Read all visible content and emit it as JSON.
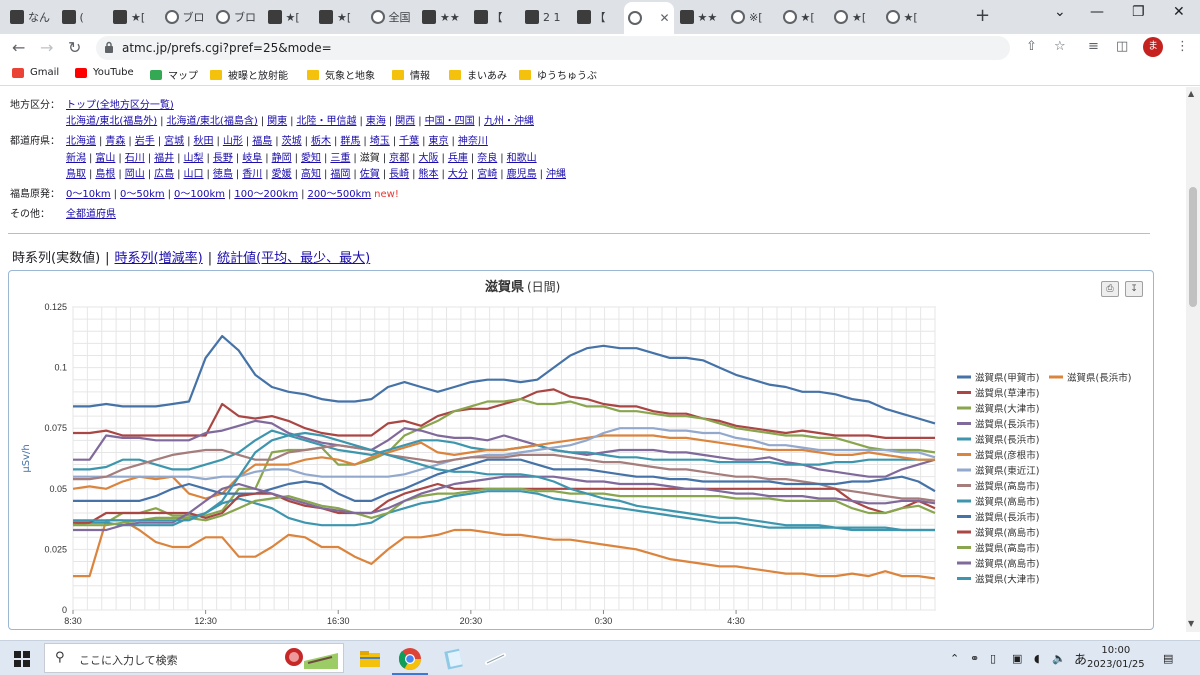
{
  "browser": {
    "tabs": [
      {
        "title": "なん",
        "icon": "site-icon"
      },
      {
        "title": "(",
        "icon": "site-icon"
      },
      {
        "title": "★[",
        "icon": "site-icon"
      },
      {
        "title": "ブロ",
        "icon": "info-icon"
      },
      {
        "title": "ブロ",
        "icon": "info-icon"
      },
      {
        "title": "★[",
        "icon": "site-icon"
      },
      {
        "title": "★[",
        "icon": "site-icon"
      },
      {
        "title": "全国",
        "icon": "globe-icon"
      },
      {
        "title": "★★",
        "icon": "site-icon"
      },
      {
        "title": "【",
        "icon": "site-icon"
      },
      {
        "title": "2 1",
        "icon": "site-icon"
      },
      {
        "title": "【",
        "icon": "site-icon"
      },
      {
        "title": "",
        "icon": "globe-icon",
        "active": true
      },
      {
        "title": "★★",
        "icon": "site-icon"
      },
      {
        "title": "※[",
        "icon": "globe-icon"
      },
      {
        "title": "★[",
        "icon": "globe-icon"
      },
      {
        "title": "★[",
        "icon": "globe-icon"
      },
      {
        "title": "★[",
        "icon": "globe-icon"
      }
    ],
    "url": "atmc.jp/prefs.cgi?pref=25&mode=",
    "avatar_letter": "ま",
    "bookmarks": [
      {
        "label": "Gmail",
        "icon": "gmail-icon"
      },
      {
        "label": "YouTube",
        "icon": "youtube-icon"
      },
      {
        "label": "マップ",
        "icon": "maps-icon"
      },
      {
        "label": "被曝と放射能",
        "icon": "folder-icon"
      },
      {
        "label": "気象と地象",
        "icon": "folder-icon"
      },
      {
        "label": "情報",
        "icon": "folder-icon"
      },
      {
        "label": "まいあみ",
        "icon": "folder-icon"
      },
      {
        "label": "ゆうちゅうぶ",
        "icon": "folder-icon"
      }
    ]
  },
  "nav": {
    "region_label": "地方区分：",
    "region_line1": [
      "トップ(全地方区分一覧)"
    ],
    "region_line2": [
      "北海道/東北(福島外)",
      "北海道/東北(福島含)",
      "関東",
      "北陸・甲信越",
      "東海",
      "関西",
      "中国・四国",
      "九州・沖縄"
    ],
    "pref_label": "都道府県：",
    "pref_line1": [
      "北海道",
      "青森",
      "岩手",
      "宮城",
      "秋田",
      "山形",
      "福島",
      "茨城",
      "栃木",
      "群馬",
      "埼玉",
      "千葉",
      "東京",
      "神奈川"
    ],
    "pref_line2": [
      "新潟",
      "富山",
      "石川",
      "福井",
      "山梨",
      "長野",
      "岐阜",
      "静岡",
      "愛知",
      "三重",
      "滋賀",
      "京都",
      "大阪",
      "兵庫",
      "奈良",
      "和歌山"
    ],
    "pref_line3": [
      "鳥取",
      "島根",
      "岡山",
      "広島",
      "山口",
      "徳島",
      "香川",
      "愛媛",
      "高知",
      "福岡",
      "佐賀",
      "長崎",
      "熊本",
      "大分",
      "宮崎",
      "鹿児島",
      "沖縄"
    ],
    "fuku_label": "福島原発：",
    "fuku_links": [
      "0〜10km",
      "0〜50km",
      "0〜100km",
      "100〜200km",
      "200〜500km"
    ],
    "new_badge": "new!",
    "other_label": "その他：",
    "other_links": [
      "全都道府県"
    ]
  },
  "view_tabs": {
    "current": "時系列(実数値)",
    "link1": "時系列(増減率)",
    "link2": "統計値(平均、最少、最大)"
  },
  "chart_data": {
    "type": "line",
    "title": "滋賀県",
    "subtitle": "(日間)",
    "ylabel": "μSv/h",
    "ylim": [
      0,
      0.125
    ],
    "yticks": [
      "0",
      "0.025",
      "0.05",
      "0.075",
      "0.1",
      "0.125"
    ],
    "xticks": [
      "8:30",
      "12:30",
      "16:30",
      "20:30",
      "0:30",
      "4:30"
    ],
    "grid": true,
    "legend_position": "right",
    "series": [
      {
        "name": "滋賀県(甲賀市)",
        "color": "#4572a7",
        "values": [
          0.084,
          0.084,
          0.085,
          0.084,
          0.084,
          0.084,
          0.085,
          0.086,
          0.104,
          0.113,
          0.107,
          0.097,
          0.092,
          0.09,
          0.089,
          0.087,
          0.086,
          0.086,
          0.087,
          0.092,
          0.094,
          0.092,
          0.09,
          0.092,
          0.094,
          0.095,
          0.095,
          0.094,
          0.095,
          0.1,
          0.105,
          0.108,
          0.109,
          0.108,
          0.108,
          0.106,
          0.104,
          0.104,
          0.103,
          0.1,
          0.097,
          0.095,
          0.093,
          0.092,
          0.09,
          0.09,
          0.089,
          0.087,
          0.086,
          0.083,
          0.081,
          0.079,
          0.077
        ]
      },
      {
        "name": "滋賀県(長浜市)",
        "color": "#db843d",
        "values": [
          0.014,
          0.014,
          0.037,
          0.037,
          0.033,
          0.028,
          0.026,
          0.026,
          0.03,
          0.03,
          0.022,
          0.022,
          0.026,
          0.031,
          0.03,
          0.026,
          0.026,
          0.022,
          0.019,
          0.025,
          0.03,
          0.03,
          0.031,
          0.033,
          0.033,
          0.032,
          0.031,
          0.031,
          0.03,
          0.029,
          0.029,
          0.028,
          0.027,
          0.026,
          0.025,
          0.023,
          0.021,
          0.02,
          0.019,
          0.018,
          0.018,
          0.017,
          0.016,
          0.015,
          0.015,
          0.014,
          0.014,
          0.015,
          0.014,
          0.016,
          0.014,
          0.014,
          0.013
        ]
      },
      {
        "name": "滋賀県(草津市)",
        "color": "#aa4643",
        "values": [
          0.073,
          0.073,
          0.074,
          0.072,
          0.072,
          0.072,
          0.072,
          0.072,
          0.072,
          0.085,
          0.08,
          0.079,
          0.08,
          0.078,
          0.075,
          0.073,
          0.072,
          0.072,
          0.072,
          0.077,
          0.078,
          0.076,
          0.08,
          0.082,
          0.083,
          0.083,
          0.085,
          0.087,
          0.09,
          0.091,
          0.088,
          0.087,
          0.085,
          0.084,
          0.084,
          0.082,
          0.081,
          0.081,
          0.079,
          0.078,
          0.076,
          0.075,
          0.074,
          0.073,
          0.074,
          0.073,
          0.072,
          0.072,
          0.072,
          0.071,
          0.071,
          0.071,
          0.071
        ]
      },
      {
        "name": "滋賀県(大津市)",
        "color": "#89a54e",
        "values": [
          0.035,
          0.036,
          0.036,
          0.04,
          0.04,
          0.042,
          0.039,
          0.039,
          0.039,
          0.041,
          0.05,
          0.05,
          0.065,
          0.066,
          0.066,
          0.067,
          0.06,
          0.06,
          0.062,
          0.065,
          0.072,
          0.075,
          0.078,
          0.082,
          0.084,
          0.086,
          0.086,
          0.087,
          0.085,
          0.085,
          0.086,
          0.084,
          0.084,
          0.082,
          0.082,
          0.081,
          0.08,
          0.08,
          0.079,
          0.077,
          0.075,
          0.074,
          0.073,
          0.072,
          0.072,
          0.071,
          0.071,
          0.069,
          0.067,
          0.066,
          0.066,
          0.066,
          0.065
        ]
      },
      {
        "name": "滋賀県(長浜市)",
        "color": "#80699b",
        "values": [
          0.062,
          0.062,
          0.072,
          0.071,
          0.071,
          0.07,
          0.07,
          0.07,
          0.073,
          0.074,
          0.076,
          0.078,
          0.077,
          0.073,
          0.071,
          0.069,
          0.068,
          0.067,
          0.066,
          0.07,
          0.075,
          0.074,
          0.072,
          0.071,
          0.071,
          0.07,
          0.072,
          0.07,
          0.068,
          0.066,
          0.065,
          0.064,
          0.065,
          0.066,
          0.066,
          0.066,
          0.065,
          0.065,
          0.064,
          0.063,
          0.062,
          0.062,
          0.063,
          0.061,
          0.06,
          0.058,
          0.057,
          0.056,
          0.055,
          0.055,
          0.058,
          0.06,
          0.062
        ]
      },
      {
        "name": "滋賀県(長浜市)",
        "color": "#3d96ae",
        "values": [
          0.058,
          0.058,
          0.059,
          0.062,
          0.062,
          0.06,
          0.058,
          0.058,
          0.06,
          0.062,
          0.065,
          0.07,
          0.074,
          0.072,
          0.07,
          0.068,
          0.066,
          0.065,
          0.064,
          0.066,
          0.068,
          0.07,
          0.07,
          0.069,
          0.067,
          0.066,
          0.066,
          0.067,
          0.068,
          0.066,
          0.065,
          0.065,
          0.064,
          0.063,
          0.063,
          0.062,
          0.062,
          0.062,
          0.062,
          0.061,
          0.061,
          0.061,
          0.061,
          0.06,
          0.06,
          0.06,
          0.061,
          0.061,
          0.062,
          0.062,
          0.062,
          0.062,
          0.062
        ]
      },
      {
        "name": "滋賀県(彦根市)",
        "color": "#db843d",
        "values": [
          0.05,
          0.051,
          0.05,
          0.053,
          0.055,
          0.054,
          0.055,
          0.048,
          0.046,
          0.048,
          0.055,
          0.06,
          0.06,
          0.06,
          0.062,
          0.063,
          0.062,
          0.06,
          0.063,
          0.065,
          0.067,
          0.069,
          0.065,
          0.064,
          0.065,
          0.066,
          0.066,
          0.067,
          0.068,
          0.069,
          0.07,
          0.071,
          0.072,
          0.072,
          0.072,
          0.072,
          0.071,
          0.071,
          0.07,
          0.069,
          0.068,
          0.067,
          0.066,
          0.066,
          0.066,
          0.065,
          0.064,
          0.064,
          0.065,
          0.064,
          0.063,
          0.062,
          0.062
        ]
      },
      {
        "name": "滋賀県(東近江)",
        "color": "#92a8cd",
        "values": [
          0.055,
          0.055,
          0.055,
          0.055,
          0.055,
          0.055,
          0.055,
          0.055,
          0.054,
          0.055,
          0.055,
          0.057,
          0.058,
          0.058,
          0.056,
          0.055,
          0.055,
          0.055,
          0.055,
          0.055,
          0.056,
          0.058,
          0.06,
          0.062,
          0.063,
          0.064,
          0.064,
          0.065,
          0.066,
          0.067,
          0.068,
          0.07,
          0.073,
          0.075,
          0.075,
          0.075,
          0.074,
          0.074,
          0.073,
          0.073,
          0.071,
          0.07,
          0.068,
          0.068,
          0.067,
          0.066,
          0.066,
          0.066,
          0.066,
          0.066,
          0.065,
          0.065,
          0.063
        ]
      },
      {
        "name": "滋賀県(高島市)",
        "color": "#a47d7c",
        "values": [
          0.054,
          0.054,
          0.055,
          0.058,
          0.06,
          0.062,
          0.064,
          0.065,
          0.066,
          0.066,
          0.064,
          0.062,
          0.062,
          0.065,
          0.066,
          0.067,
          0.068,
          0.067,
          0.066,
          0.064,
          0.063,
          0.062,
          0.061,
          0.062,
          0.063,
          0.063,
          0.063,
          0.064,
          0.064,
          0.064,
          0.063,
          0.062,
          0.061,
          0.061,
          0.06,
          0.059,
          0.058,
          0.058,
          0.057,
          0.056,
          0.055,
          0.055,
          0.054,
          0.054,
          0.053,
          0.052,
          0.05,
          0.049,
          0.048,
          0.047,
          0.046,
          0.046,
          0.045
        ]
      },
      {
        "name": "滋賀県(高島市)",
        "color": "#3d96ae",
        "values": [
          0.036,
          0.036,
          0.036,
          0.035,
          0.035,
          0.035,
          0.035,
          0.038,
          0.04,
          0.044,
          0.046,
          0.044,
          0.042,
          0.038,
          0.036,
          0.035,
          0.035,
          0.035,
          0.036,
          0.04,
          0.042,
          0.044,
          0.045,
          0.047,
          0.048,
          0.049,
          0.049,
          0.049,
          0.048,
          0.046,
          0.045,
          0.044,
          0.043,
          0.042,
          0.041,
          0.04,
          0.039,
          0.038,
          0.037,
          0.036,
          0.036,
          0.035,
          0.034,
          0.034,
          0.034,
          0.034,
          0.034,
          0.033,
          0.033,
          0.033,
          0.033,
          0.033,
          0.033
        ]
      },
      {
        "name": "滋賀県(長浜市)",
        "color": "#4572a7",
        "values": [
          0.045,
          0.045,
          0.045,
          0.045,
          0.045,
          0.047,
          0.05,
          0.052,
          0.05,
          0.048,
          0.048,
          0.048,
          0.05,
          0.052,
          0.053,
          0.052,
          0.048,
          0.045,
          0.045,
          0.048,
          0.05,
          0.053,
          0.056,
          0.058,
          0.06,
          0.062,
          0.062,
          0.062,
          0.06,
          0.058,
          0.058,
          0.058,
          0.057,
          0.056,
          0.055,
          0.055,
          0.054,
          0.054,
          0.053,
          0.053,
          0.053,
          0.053,
          0.053,
          0.052,
          0.052,
          0.052,
          0.052,
          0.053,
          0.053,
          0.054,
          0.055,
          0.053,
          0.049
        ]
      },
      {
        "name": "滋賀県(高島市)",
        "color": "#aa4643",
        "values": [
          0.036,
          0.036,
          0.04,
          0.04,
          0.04,
          0.04,
          0.04,
          0.04,
          0.038,
          0.04,
          0.047,
          0.048,
          0.048,
          0.045,
          0.043,
          0.042,
          0.04,
          0.04,
          0.04,
          0.045,
          0.048,
          0.05,
          0.052,
          0.05,
          0.05,
          0.05,
          0.05,
          0.05,
          0.05,
          0.05,
          0.05,
          0.05,
          0.05,
          0.05,
          0.05,
          0.05,
          0.05,
          0.05,
          0.05,
          0.05,
          0.05,
          0.05,
          0.05,
          0.05,
          0.05,
          0.05,
          0.05,
          0.045,
          0.042,
          0.04,
          0.042,
          0.045,
          0.042
        ]
      },
      {
        "name": "滋賀県(高島市)",
        "color": "#89a54e",
        "values": [
          0.035,
          0.035,
          0.035,
          0.036,
          0.037,
          0.038,
          0.038,
          0.038,
          0.037,
          0.039,
          0.042,
          0.045,
          0.046,
          0.047,
          0.045,
          0.043,
          0.042,
          0.04,
          0.038,
          0.04,
          0.045,
          0.047,
          0.048,
          0.048,
          0.049,
          0.05,
          0.05,
          0.05,
          0.049,
          0.049,
          0.048,
          0.048,
          0.048,
          0.047,
          0.047,
          0.047,
          0.047,
          0.047,
          0.047,
          0.047,
          0.046,
          0.046,
          0.046,
          0.045,
          0.045,
          0.045,
          0.045,
          0.042,
          0.04,
          0.04,
          0.042,
          0.043,
          0.04
        ]
      },
      {
        "name": "滋賀県(高島市)",
        "color": "#80699b",
        "values": [
          0.033,
          0.033,
          0.033,
          0.035,
          0.036,
          0.036,
          0.036,
          0.04,
          0.045,
          0.05,
          0.052,
          0.05,
          0.048,
          0.046,
          0.044,
          0.042,
          0.041,
          0.04,
          0.04,
          0.042,
          0.045,
          0.048,
          0.05,
          0.052,
          0.053,
          0.054,
          0.055,
          0.055,
          0.055,
          0.055,
          0.054,
          0.053,
          0.053,
          0.052,
          0.052,
          0.052,
          0.051,
          0.05,
          0.05,
          0.049,
          0.048,
          0.048,
          0.047,
          0.047,
          0.047,
          0.046,
          0.046,
          0.045,
          0.044,
          0.044,
          0.045,
          0.045,
          0.044
        ]
      },
      {
        "name": "滋賀県(大津市)",
        "color": "#3d96ae",
        "values": [
          0.037,
          0.037,
          0.037,
          0.037,
          0.037,
          0.037,
          0.037,
          0.037,
          0.04,
          0.045,
          0.055,
          0.065,
          0.07,
          0.072,
          0.073,
          0.072,
          0.07,
          0.068,
          0.066,
          0.064,
          0.062,
          0.06,
          0.058,
          0.057,
          0.057,
          0.056,
          0.056,
          0.056,
          0.055,
          0.053,
          0.05,
          0.048,
          0.046,
          0.045,
          0.043,
          0.042,
          0.041,
          0.04,
          0.039,
          0.038,
          0.038,
          0.037,
          0.036,
          0.035,
          0.035,
          0.035,
          0.034,
          0.034,
          0.034,
          0.034,
          0.033,
          0.033,
          0.033
        ]
      }
    ]
  },
  "taskbar": {
    "search_placeholder": "ここに入力して検索",
    "time": "10:00",
    "date": "2023/01/25",
    "ime": "あ"
  }
}
